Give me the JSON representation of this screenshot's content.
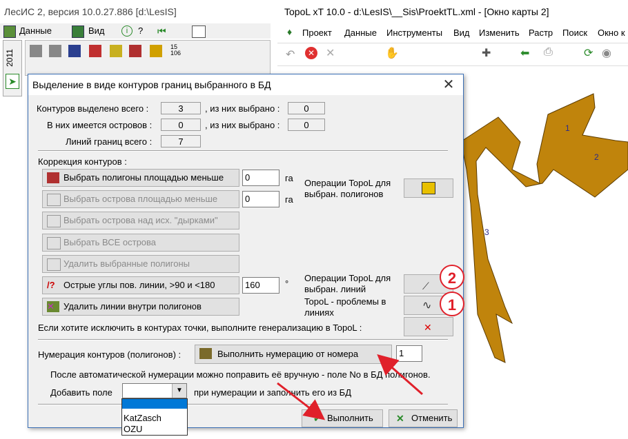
{
  "les_window": {
    "title": "ЛесИС 2, версия 10.0.27.886  [d:\\LesIS]",
    "menu": [
      "Данные",
      "Вид",
      "?"
    ],
    "side_tab": "2011",
    "tb_badge": "15\n106"
  },
  "topo_window": {
    "title": "TopoL xT 10.0 - d:\\LesIS\\__Sis\\ProektTL.xml - [Окно карты 2]",
    "menu": [
      "Проект",
      "Данные",
      "Инструменты",
      "Вид",
      "Изменить",
      "Растр",
      "Поиск",
      "Окно к"
    ],
    "polygon_labels": [
      "1",
      "2",
      "3"
    ],
    "fill_color": "#c0840c"
  },
  "dialog": {
    "title": "Выделение в виде контуров границ выбранного в БД",
    "stats": {
      "contours_label": "Контуров выделено всего :",
      "contours_value": "3",
      "contours_sel_label": ", из них выбрано :",
      "contours_sel_value": "0",
      "islands_label": "В них имеется островов :",
      "islands_value": "0",
      "islands_sel_label": ", из них выбрано :",
      "islands_sel_value": "0",
      "lines_label": "Линий границ всего :",
      "lines_value": "7"
    },
    "correction_label": "Коррекция контуров :",
    "buttons": {
      "select_polygons": "Выбрать полигоны площадью меньше",
      "select_islands_area": "Выбрать острова площадью меньше",
      "select_islands_holes": "Выбрать острова над исх. \"дырками\"",
      "select_all_islands": "Выбрать ВСЕ острова",
      "delete_polygons": "Удалить выбранные полигоны",
      "sharp_angles": "Острые углы пов. линии, >90 и <180",
      "delete_inner_lines": "Удалить линии внутри полигонов",
      "numbering": "Выполнить нумерацию от номера",
      "execute": "Выполнить",
      "cancel": "Отменить"
    },
    "inputs": {
      "polygon_area": "0",
      "polygon_area_unit": "га",
      "island_area": "0",
      "island_area_unit": "га",
      "angle": "160",
      "angle_unit": "°",
      "numbering_start": "1"
    },
    "topol_ops_polygons": "Операции TopoL для выбран. полигонов",
    "topol_ops_lines": "Операции TopoL для выбран. линий",
    "topol_problems": "TopoL - проблемы в линиях",
    "generalization_note": "Если хотите исключить в контурах точки, выполните генерализацию в TopoL :",
    "numbering_label": "Нумерация контуров (полигонов) :",
    "after_numbering_note": "После автоматической нумерации можно  поправить её вручную - поле No в БД полигонов.",
    "add_field_label": "Добавить поле",
    "add_field_suffix": "при нумерации  и заполнить его из БД",
    "add_field_value": "",
    "add_field_options": [
      "KatZasch",
      "OZU"
    ],
    "callouts": [
      "2",
      "1"
    ],
    "accent_red": "#e0202a"
  }
}
